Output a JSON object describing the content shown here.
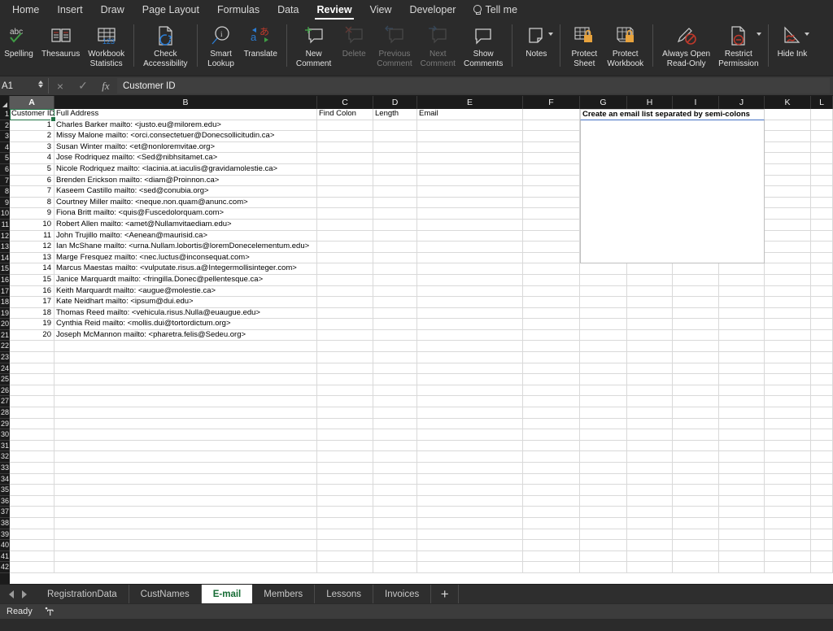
{
  "app": {
    "status_text": "Ready"
  },
  "ribbon": {
    "tabs": [
      {
        "label": "Home",
        "active": false
      },
      {
        "label": "Insert",
        "active": false
      },
      {
        "label": "Draw",
        "active": false
      },
      {
        "label": "Page Layout",
        "active": false
      },
      {
        "label": "Formulas",
        "active": false
      },
      {
        "label": "Data",
        "active": false
      },
      {
        "label": "Review",
        "active": true
      },
      {
        "label": "View",
        "active": false
      },
      {
        "label": "Developer",
        "active": false
      },
      {
        "label": "Tell me",
        "active": false
      }
    ],
    "buttons": [
      {
        "label": "Spelling",
        "icon": "abc-check-icon",
        "disabled": false,
        "chevron": false
      },
      {
        "label": "Thesaurus",
        "icon": "book-icon",
        "disabled": false,
        "chevron": false
      },
      {
        "label": "Workbook\nStatistics",
        "icon": "table-123-icon",
        "disabled": false,
        "chevron": false
      },
      {
        "label": "Check\nAccessibility",
        "icon": "page-accessibility-icon",
        "disabled": false,
        "chevron": false
      },
      {
        "label": "Smart\nLookup",
        "icon": "magnifier-info-icon",
        "disabled": false,
        "chevron": false
      },
      {
        "label": "Translate",
        "icon": "translate-icon",
        "disabled": false,
        "chevron": false
      },
      {
        "label": "New\nComment",
        "icon": "comment-plus-icon",
        "disabled": false,
        "chevron": false
      },
      {
        "label": "Delete",
        "icon": "comment-delete-icon",
        "disabled": true,
        "chevron": false
      },
      {
        "label": "Previous\nComment",
        "icon": "comment-previous-icon",
        "disabled": true,
        "chevron": false
      },
      {
        "label": "Next\nComment",
        "icon": "comment-next-icon",
        "disabled": true,
        "chevron": false
      },
      {
        "label": "Show\nComments",
        "icon": "comment-show-icon",
        "disabled": false,
        "chevron": false
      },
      {
        "label": "Notes",
        "icon": "note-icon",
        "disabled": false,
        "chevron": true
      },
      {
        "label": "Protect\nSheet",
        "icon": "protect-sheet-icon",
        "disabled": false,
        "chevron": false
      },
      {
        "label": "Protect\nWorkbook",
        "icon": "protect-workbook-icon",
        "disabled": false,
        "chevron": false
      },
      {
        "label": "Always Open\nRead-Only",
        "icon": "pencil-block-icon",
        "disabled": false,
        "chevron": false
      },
      {
        "label": "Restrict\nPermission",
        "icon": "restrict-permission-icon",
        "disabled": false,
        "chevron": true
      },
      {
        "label": "Hide Ink",
        "icon": "hide-ink-icon",
        "disabled": false,
        "chevron": true
      }
    ]
  },
  "formula_bar": {
    "name_box": "A1",
    "cancel_icon": "×",
    "confirm_icon": "✓",
    "fx_label": "fx",
    "content": "Customer ID"
  },
  "grid": {
    "columns": [
      "A",
      "B",
      "C",
      "D",
      "E",
      "F",
      "G",
      "H",
      "I",
      "J",
      "K",
      "L"
    ],
    "selected_column": "A",
    "selected_cell": "A1",
    "row_numbers": [
      "1",
      "2",
      "3",
      "4",
      "5",
      "6",
      "7",
      "8",
      "9",
      "10",
      "11",
      "12",
      "13",
      "14",
      "15",
      "16",
      "17",
      "18",
      "19",
      "20",
      "21",
      "22",
      "23",
      "24",
      "25",
      "26",
      "27",
      "28",
      "29",
      "30",
      "31",
      "32",
      "33",
      "34",
      "35",
      "36",
      "37",
      "38",
      "39",
      "40",
      "41",
      "42"
    ],
    "headers": {
      "A": "Customer ID",
      "B": "Full Address",
      "C": "Find Colon",
      "D": "Length",
      "E": "Email",
      "G": "Create an email list separated by semi-colons"
    },
    "rows": [
      {
        "id": "1",
        "address": "Charles Barker mailto: <justo.eu@milorem.edu>"
      },
      {
        "id": "2",
        "address": "Missy Malone mailto: <orci.consectetuer@Donecsollicitudin.ca>"
      },
      {
        "id": "3",
        "address": "Susan Winter mailto: <et@nonloremvitae.org>"
      },
      {
        "id": "4",
        "address": "Jose Rodriquez mailto: <Sed@nibhsitamet.ca>"
      },
      {
        "id": "5",
        "address": "Nicole Rodriquez mailto: <lacinia.at.iaculis@gravidamolestie.ca>"
      },
      {
        "id": "6",
        "address": "Brenden Erickson mailto: <diam@Proinnon.ca>"
      },
      {
        "id": "7",
        "address": "Kaseem Castillo mailto: <sed@conubia.org>"
      },
      {
        "id": "8",
        "address": "Courtney Miller mailto: <neque.non.quam@anunc.com>"
      },
      {
        "id": "9",
        "address": "Fiona Britt mailto: <quis@Fuscedolorquam.com>"
      },
      {
        "id": "10",
        "address": "Robert Allen mailto: <amet@Nullamvitaediam.edu>"
      },
      {
        "id": "11",
        "address": "John Trujillo mailto: <Aenean@maurisid.ca>"
      },
      {
        "id": "12",
        "address": "Ian McShane mailto: <urna.Nullam.lobortis@loremDonecelementum.edu>"
      },
      {
        "id": "13",
        "address": "Marge Fresquez mailto: <nec.luctus@inconsequat.com>"
      },
      {
        "id": "14",
        "address": "Marcus Maestas mailto: <vulputate.risus.a@Integermollisinteger.com>"
      },
      {
        "id": "15",
        "address": "Janice Marquardt mailto: <fringilla.Donec@pellentesque.ca>"
      },
      {
        "id": "16",
        "address": "Keith Marquardt mailto: <augue@molestie.ca>"
      },
      {
        "id": "17",
        "address": "Kate Neidhart mailto: <ipsum@dui.edu>"
      },
      {
        "id": "18",
        "address": "Thomas Reed mailto: <vehicula.risus.Nulla@euaugue.edu>"
      },
      {
        "id": "19",
        "address": "Cynthia Reid mailto: <mollis.dui@tortordictum.org>"
      },
      {
        "id": "20",
        "address": "Joseph McMannon mailto: <pharetra.felis@Sedeu.org>"
      }
    ]
  },
  "sheet_tabs": {
    "prev_icon": "nav-prev-icon",
    "next_icon": "nav-next-icon",
    "items": [
      {
        "label": "RegistrationData",
        "active": false
      },
      {
        "label": "CustNames",
        "active": false
      },
      {
        "label": "E-mail",
        "active": true
      },
      {
        "label": "Members",
        "active": false
      },
      {
        "label": "Lessons",
        "active": false
      },
      {
        "label": "Invoices",
        "active": false
      }
    ],
    "add_label": "+"
  },
  "colors": {
    "accent_green": "#217346",
    "ribbon_bg": "#2b2b2b",
    "merge_border_blue": "#4472c4"
  }
}
